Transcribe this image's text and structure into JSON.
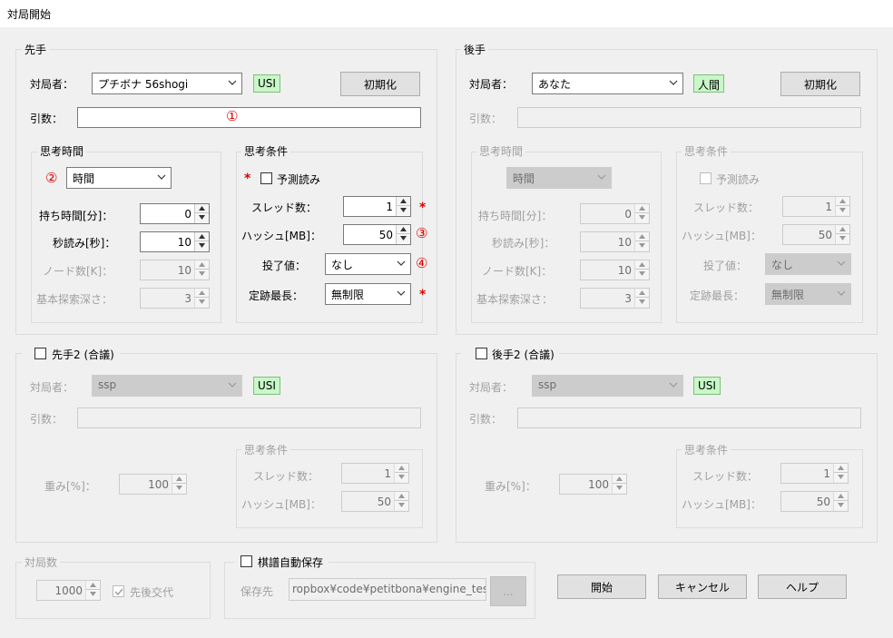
{
  "window": {
    "title": "対局開始"
  },
  "sente": {
    "group_title": "先手",
    "player_label": "対局者：",
    "player_value": "プチボナ 56shogi",
    "engine_type": "USI",
    "init_button": "初期化",
    "args_label": "引数：",
    "args_value": "",
    "think_time": {
      "title": "思考時間",
      "mode": "時間",
      "rows": [
        {
          "label": "持ち時間[分]：",
          "value": "0"
        },
        {
          "label": "秒読み[秒]：",
          "value": "10"
        },
        {
          "label": "ノード数[K]：",
          "value": "10"
        },
        {
          "label": "基本探索深さ：",
          "value": "3"
        }
      ]
    },
    "think_cond": {
      "title": "思考条件",
      "ponder_label": "予測読み",
      "threads_label": "スレッド数：",
      "threads_value": "1",
      "hash_label": "ハッシュ[MB]：",
      "hash_value": "50",
      "resign_label": "投了値：",
      "resign_value": "なし",
      "book_label": "定跡最長：",
      "book_value": "無制限"
    }
  },
  "gote": {
    "group_title": "後手",
    "player_label": "対局者：",
    "player_value": "あなた",
    "engine_type": "人間",
    "init_button": "初期化",
    "args_label": "引数：",
    "think_time": {
      "title": "思考時間",
      "mode": "時間",
      "rows": [
        {
          "label": "持ち時間[分]：",
          "value": "0"
        },
        {
          "label": "秒読み[秒]：",
          "value": "10"
        },
        {
          "label": "ノード数[K]：",
          "value": "10"
        },
        {
          "label": "基本探索深さ：",
          "value": "3"
        }
      ]
    },
    "think_cond": {
      "title": "思考条件",
      "ponder_label": "予測読み",
      "threads_label": "スレッド数：",
      "threads_value": "1",
      "hash_label": "ハッシュ[MB]：",
      "hash_value": "50",
      "resign_label": "投了値：",
      "resign_value": "なし",
      "book_label": "定跡最長：",
      "book_value": "無制限"
    }
  },
  "sente2": {
    "group_title": "先手2 (合議)",
    "player_label": "対局者：",
    "player_value": "ssp",
    "engine_type": "USI",
    "args_label": "引数：",
    "weight_label": "重み[%]：",
    "weight_value": "100",
    "cond_title": "思考条件",
    "threads_label": "スレッド数：",
    "threads_value": "1",
    "hash_label": "ハッシュ[MB]：",
    "hash_value": "50"
  },
  "gote2": {
    "group_title": "後手2 (合議)",
    "player_label": "対局者：",
    "player_value": "ssp",
    "engine_type": "USI",
    "args_label": "引数：",
    "weight_label": "重み[%]：",
    "weight_value": "100",
    "cond_title": "思考条件",
    "threads_label": "スレッド数：",
    "threads_value": "1",
    "hash_label": "ハッシュ[MB]：",
    "hash_value": "50"
  },
  "games": {
    "title": "対局数",
    "count": "1000",
    "alternate_label": "先後交代"
  },
  "autosave": {
    "title": "棋譜自動保存",
    "path_label": "保存先",
    "path_value": "ropbox¥code¥petitbona¥engine_test",
    "browse_label": "..."
  },
  "buttons": {
    "start": "開始",
    "cancel": "キャンセル",
    "help": "ヘルプ"
  },
  "annotations": {
    "m1": "①",
    "m2": "②",
    "m3": "③",
    "m4": "④",
    "star": "*"
  },
  "colors": {
    "annotation": "#e00000",
    "badge_bg": "#c8f7c8",
    "disabled_text": "#a0a0a0"
  }
}
